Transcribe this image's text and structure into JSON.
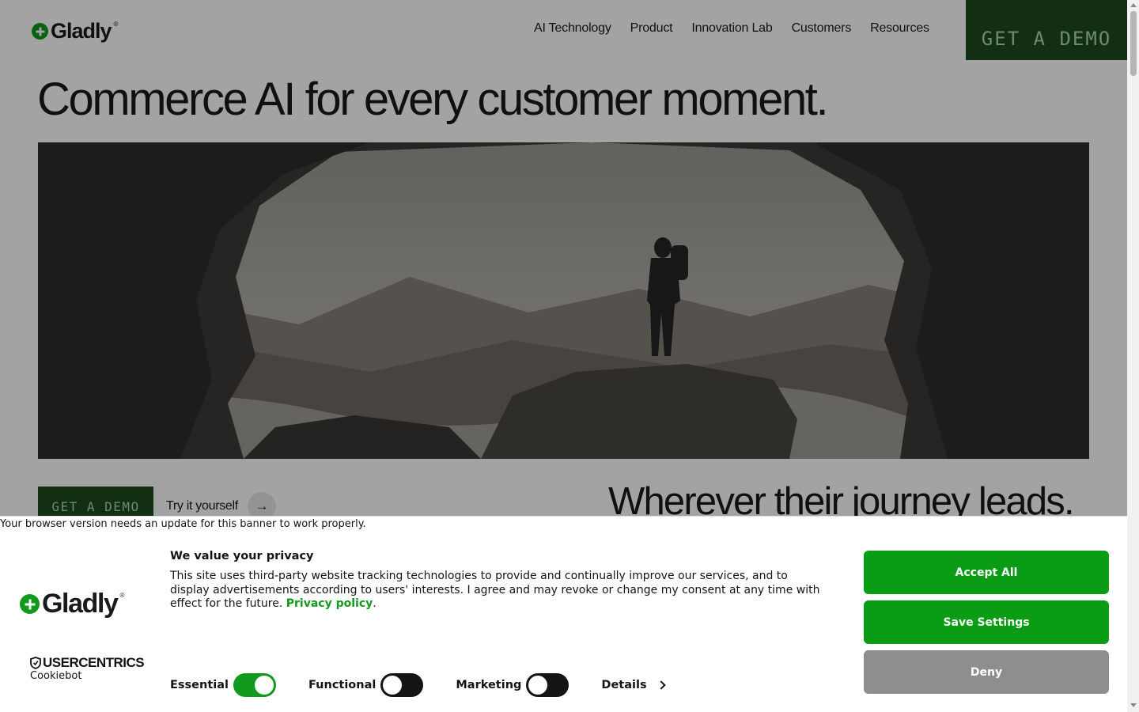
{
  "header": {
    "logo_text": "Gladly",
    "logo_mark": "®",
    "nav": [
      "AI Technology",
      "Product",
      "Innovation Lab",
      "Customers",
      "Resources"
    ],
    "cta": "GET A DEMO"
  },
  "hero": {
    "title": "Commerce AI for every customer moment.",
    "image_alt": "hiker-in-cave-mouth-image",
    "cta_primary": "GET A DEMO",
    "cta_secondary": "Try it yourself",
    "subheading": "Wherever their journey leads."
  },
  "banner": {
    "browser_note": "Your browser version needs an update for this banner to work properly.",
    "logo_text": "Gladly",
    "logo_mark": "®",
    "uc_brand": "USERCENTRICS",
    "uc_product": "Cookiebot",
    "title": "We value your privacy",
    "body": "This site uses third-party website tracking technologies to provide and continually improve our services, and to display advertisements according to users' interests. I agree and may revoke or change my consent at any time with effect for the future.",
    "privacy_link": "Privacy policy",
    "toggles": [
      {
        "label": "Essential",
        "on": true
      },
      {
        "label": "Functional",
        "on": false
      },
      {
        "label": "Marketing",
        "on": false
      }
    ],
    "details_label": "Details",
    "accept_label": "Accept All",
    "save_label": "Save Settings",
    "deny_label": "Deny"
  },
  "colors": {
    "brand_green": "#119a1c",
    "dark_green": "#1d4a1d",
    "deny_gray": "#8e8e8e"
  }
}
